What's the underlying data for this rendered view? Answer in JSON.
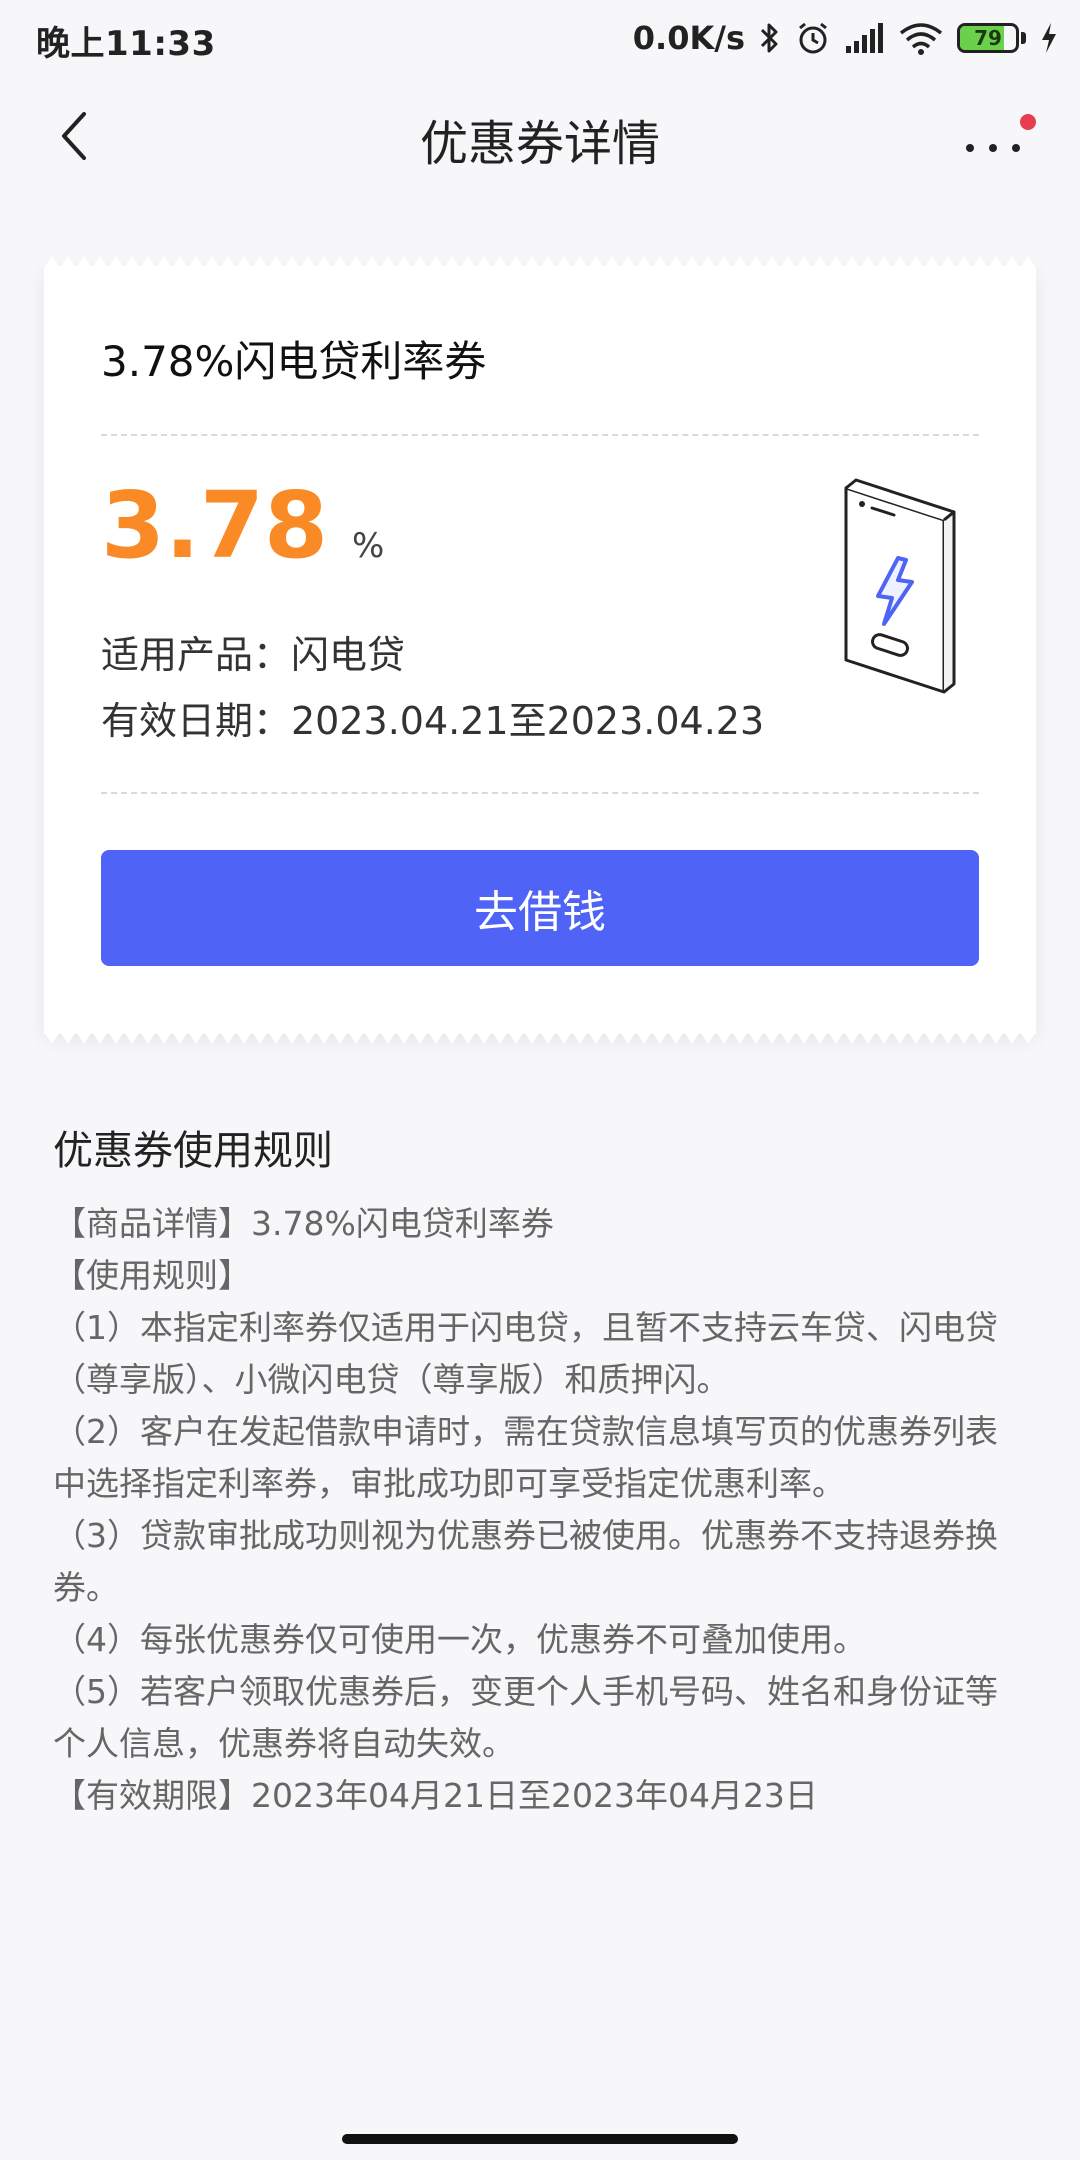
{
  "status_bar": {
    "time": "晚上11:33",
    "net_speed": "0.0K/s",
    "battery_level": "79",
    "battery_fraction": 0.79,
    "icons": [
      "bluetooth-icon",
      "alarm-icon",
      "signal-icon",
      "wifi-icon",
      "battery-icon",
      "charging-icon"
    ]
  },
  "header": {
    "title": "优惠券详情",
    "back_icon": "chevron-left-icon",
    "more_icon": "more-dots-icon",
    "has_notification_dot": true
  },
  "coupon": {
    "name": "3.78%闪电贷利率券",
    "rate_value": "3.78",
    "rate_unit": "%",
    "product_line": "适用产品：闪电贷",
    "validity_line": "有效日期：2023.04.21至2023.04.23",
    "illustration_icon": "phone-lightning-icon",
    "button_label": "去借钱"
  },
  "rules": {
    "title": "优惠券使用规则",
    "lines": [
      "【商品详情】3.78%闪电贷利率券",
      "【使用规则】",
      "（1）本指定利率券仅适用于闪电贷，且暂不支持云车贷、闪电贷（尊享版）、小微闪电贷（尊享版）和质押闪。",
      "（2）客户在发起借款申请时，需在贷款信息填写页的优惠券列表中选择指定利率券，审批成功即可享受指定优惠利率。",
      "（3）贷款审批成功则视为优惠券已被使用。优惠券不支持退券换券。",
      "（4）每张优惠券仅可使用一次，优惠券不可叠加使用。",
      "（5）若客户领取优惠券后，变更个人手机号码、姓名和身份证等个人信息，优惠券将自动失效。",
      "【有效期限】2023年04月21日至2023年04月23日"
    ]
  },
  "colors": {
    "accent_button": "#4f63f7",
    "rate_orange": "#fa8a25",
    "badge_red": "#e63e4e",
    "battery_green": "#6bd14a",
    "background": "#f7f7f9"
  }
}
